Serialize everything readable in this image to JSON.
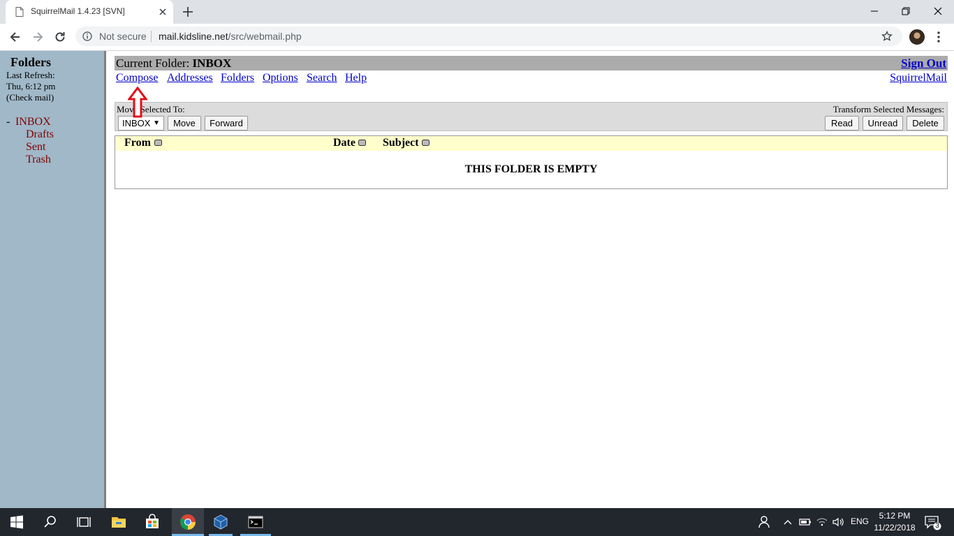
{
  "browser": {
    "tab_title": "SquirrelMail 1.4.23 [SVN]",
    "security_label": "Not secure",
    "url_host": "mail.kidsline.net",
    "url_path": "/src/webmail.php"
  },
  "left": {
    "title": "Folders",
    "last_refresh_label": "Last Refresh:",
    "last_refresh_time": "Thu, 6:12 pm",
    "check_mail_open": "(",
    "check_mail_label": "Check mail",
    "check_mail_close": ")",
    "expander": "-",
    "folders": [
      "INBOX",
      "Drafts",
      "Sent",
      "Trash"
    ]
  },
  "header": {
    "current_folder_label": "Current Folder: ",
    "current_folder": "INBOX",
    "sign_out": "Sign Out",
    "menu": [
      "Compose",
      "Addresses",
      "Folders",
      "Options",
      "Search",
      "Help"
    ],
    "brand_link": "SquirrelMail"
  },
  "ops": {
    "move_label": "Move Selected To:",
    "move_target": "INBOX",
    "move_button": "Move",
    "forward_button": "Forward",
    "transform_label": "Transform Selected Messages:",
    "read_button": "Read",
    "unread_button": "Unread",
    "delete_button": "Delete"
  },
  "messages": {
    "columns": [
      "From",
      "Date",
      "Subject"
    ],
    "empty_text": "THIS FOLDER IS EMPTY"
  },
  "annotation": {
    "icon": "up-arrow-icon",
    "color": "#e0101a"
  },
  "taskbar": {
    "time": "5:12 PM",
    "date": "11/22/2018",
    "language": "ENG",
    "notification_count": "3"
  },
  "icons": {
    "tab": "page-icon",
    "close": "close-icon",
    "new_tab": "plus-icon",
    "back": "back-arrow-icon",
    "forward": "forward-arrow-icon",
    "reload": "reload-icon",
    "info": "info-icon",
    "bookmark": "star-icon",
    "menu": "kebab-menu-icon"
  }
}
